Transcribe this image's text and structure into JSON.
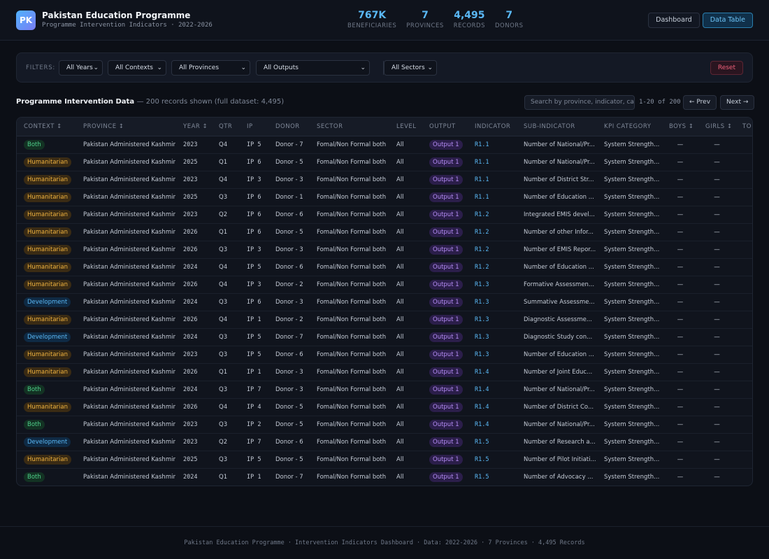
{
  "header": {
    "logo_text": "PK",
    "title": "Pakistan Education Programme",
    "subtitle": "Programme Intervention Indicators · 2022-2026",
    "stats": [
      {
        "value": "767K",
        "label": "BENEFICIARIES"
      },
      {
        "value": "7",
        "label": "PROVINCES"
      },
      {
        "value": "4,495",
        "label": "RECORDS"
      },
      {
        "value": "7",
        "label": "DONORS"
      }
    ],
    "nav": {
      "dashboard": "Dashboard",
      "data_table": "Data Table"
    }
  },
  "filters": {
    "label": "FILTERS:",
    "years": "All Years",
    "contexts": "All Contexts",
    "provinces": "All Provinces",
    "outputs": "All Outputs",
    "sectors": "All Sectors",
    "reset": "Reset"
  },
  "section": {
    "title": "Programme Intervention Data",
    "note": "— 200 records shown (full dataset: 4,495)",
    "search_placeholder": "Search by province, indicator, category...",
    "page_info": "1-20 of 200",
    "prev": "← Prev",
    "next": "Next →"
  },
  "table": {
    "columns": [
      "CONTEXT ↕",
      "PROVINCE ↕",
      "YEAR ↕",
      "QTR",
      "IP",
      "DONOR",
      "SECTOR",
      "LEVEL",
      "OUTPUT",
      "INDICATOR",
      "SUB-INDICATOR",
      "KPI CATEGORY",
      "BOYS ↕",
      "GIRLS ↕",
      "TO"
    ],
    "rows": [
      {
        "context": "Both",
        "province": "Pakistan Administered Kashmir",
        "year": "2023",
        "qtr": "Q4",
        "ip": "IP 5",
        "donor": "Donor - 7",
        "sector": "Fomal/Non Formal both",
        "level": "All",
        "output": "Output 1",
        "indicator": "R1.1",
        "sub": "Number of National/Pr...",
        "kpi": "System Strength...",
        "boys": "—",
        "girls": "—"
      },
      {
        "context": "Humanitarian",
        "province": "Pakistan Administered Kashmir",
        "year": "2025",
        "qtr": "Q1",
        "ip": "IP 6",
        "donor": "Donor - 5",
        "sector": "Fomal/Non Formal both",
        "level": "All",
        "output": "Output 1",
        "indicator": "R1.1",
        "sub": "Number of National/Pr...",
        "kpi": "System Strength...",
        "boys": "—",
        "girls": "—"
      },
      {
        "context": "Humanitarian",
        "province": "Pakistan Administered Kashmir",
        "year": "2023",
        "qtr": "Q4",
        "ip": "IP 3",
        "donor": "Donor - 3",
        "sector": "Fomal/Non Formal both",
        "level": "All",
        "output": "Output 1",
        "indicator": "R1.1",
        "sub": "Number of District Str...",
        "kpi": "System Strength...",
        "boys": "—",
        "girls": "—"
      },
      {
        "context": "Humanitarian",
        "province": "Pakistan Administered Kashmir",
        "year": "2025",
        "qtr": "Q3",
        "ip": "IP 6",
        "donor": "Donor - 1",
        "sector": "Fomal/Non Formal both",
        "level": "All",
        "output": "Output 1",
        "indicator": "R1.1",
        "sub": "Number of Education ...",
        "kpi": "System Strength...",
        "boys": "—",
        "girls": "—"
      },
      {
        "context": "Humanitarian",
        "province": "Pakistan Administered Kashmir",
        "year": "2023",
        "qtr": "Q2",
        "ip": "IP 6",
        "donor": "Donor - 6",
        "sector": "Fomal/Non Formal both",
        "level": "All",
        "output": "Output 1",
        "indicator": "R1.2",
        "sub": "Integrated EMIS devel...",
        "kpi": "System Strength...",
        "boys": "—",
        "girls": "—"
      },
      {
        "context": "Humanitarian",
        "province": "Pakistan Administered Kashmir",
        "year": "2026",
        "qtr": "Q1",
        "ip": "IP 6",
        "donor": "Donor - 5",
        "sector": "Fomal/Non Formal both",
        "level": "All",
        "output": "Output 1",
        "indicator": "R1.2",
        "sub": "Number of other Infor...",
        "kpi": "System Strength...",
        "boys": "—",
        "girls": "—"
      },
      {
        "context": "Humanitarian",
        "province": "Pakistan Administered Kashmir",
        "year": "2026",
        "qtr": "Q3",
        "ip": "IP 3",
        "donor": "Donor - 3",
        "sector": "Fomal/Non Formal both",
        "level": "All",
        "output": "Output 1",
        "indicator": "R1.2",
        "sub": "Number of EMIS Repor...",
        "kpi": "System Strength...",
        "boys": "—",
        "girls": "—"
      },
      {
        "context": "Humanitarian",
        "province": "Pakistan Administered Kashmir",
        "year": "2024",
        "qtr": "Q4",
        "ip": "IP 5",
        "donor": "Donor - 6",
        "sector": "Fomal/Non Formal both",
        "level": "All",
        "output": "Output 1",
        "indicator": "R1.2",
        "sub": "Number of Education ...",
        "kpi": "System Strength...",
        "boys": "—",
        "girls": "—"
      },
      {
        "context": "Humanitarian",
        "province": "Pakistan Administered Kashmir",
        "year": "2026",
        "qtr": "Q4",
        "ip": "IP 3",
        "donor": "Donor - 2",
        "sector": "Fomal/Non Formal both",
        "level": "All",
        "output": "Output 1",
        "indicator": "R1.3",
        "sub": "Formative Assessmen...",
        "kpi": "System Strength...",
        "boys": "—",
        "girls": "—"
      },
      {
        "context": "Development",
        "province": "Pakistan Administered Kashmir",
        "year": "2024",
        "qtr": "Q3",
        "ip": "IP 6",
        "donor": "Donor - 3",
        "sector": "Fomal/Non Formal both",
        "level": "All",
        "output": "Output 1",
        "indicator": "R1.3",
        "sub": "Summative Assessme...",
        "kpi": "System Strength...",
        "boys": "—",
        "girls": "—"
      },
      {
        "context": "Humanitarian",
        "province": "Pakistan Administered Kashmir",
        "year": "2026",
        "qtr": "Q4",
        "ip": "IP 1",
        "donor": "Donor - 2",
        "sector": "Fomal/Non Formal both",
        "level": "All",
        "output": "Output 1",
        "indicator": "R1.3",
        "sub": "Diagnostic Assessme...",
        "kpi": "System Strength...",
        "boys": "—",
        "girls": "—"
      },
      {
        "context": "Development",
        "province": "Pakistan Administered Kashmir",
        "year": "2024",
        "qtr": "Q3",
        "ip": "IP 5",
        "donor": "Donor - 7",
        "sector": "Fomal/Non Formal both",
        "level": "All",
        "output": "Output 1",
        "indicator": "R1.3",
        "sub": "Diagnostic Study con...",
        "kpi": "System Strength...",
        "boys": "—",
        "girls": "—"
      },
      {
        "context": "Humanitarian",
        "province": "Pakistan Administered Kashmir",
        "year": "2023",
        "qtr": "Q3",
        "ip": "IP 5",
        "donor": "Donor - 6",
        "sector": "Fomal/Non Formal both",
        "level": "All",
        "output": "Output 1",
        "indicator": "R1.3",
        "sub": "Number of Education ...",
        "kpi": "System Strength...",
        "boys": "—",
        "girls": "—"
      },
      {
        "context": "Humanitarian",
        "province": "Pakistan Administered Kashmir",
        "year": "2026",
        "qtr": "Q1",
        "ip": "IP 1",
        "donor": "Donor - 3",
        "sector": "Fomal/Non Formal both",
        "level": "All",
        "output": "Output 1",
        "indicator": "R1.4",
        "sub": "Number of Joint Educ...",
        "kpi": "System Strength...",
        "boys": "—",
        "girls": "—"
      },
      {
        "context": "Both",
        "province": "Pakistan Administered Kashmir",
        "year": "2024",
        "qtr": "Q3",
        "ip": "IP 7",
        "donor": "Donor - 3",
        "sector": "Fomal/Non Formal both",
        "level": "All",
        "output": "Output 1",
        "indicator": "R1.4",
        "sub": "Number of National/Pr...",
        "kpi": "System Strength...",
        "boys": "—",
        "girls": "—"
      },
      {
        "context": "Humanitarian",
        "province": "Pakistan Administered Kashmir",
        "year": "2026",
        "qtr": "Q4",
        "ip": "IP 4",
        "donor": "Donor - 5",
        "sector": "Fomal/Non Formal both",
        "level": "All",
        "output": "Output 1",
        "indicator": "R1.4",
        "sub": "Number of District Co...",
        "kpi": "System Strength...",
        "boys": "—",
        "girls": "—"
      },
      {
        "context": "Both",
        "province": "Pakistan Administered Kashmir",
        "year": "2023",
        "qtr": "Q3",
        "ip": "IP 2",
        "donor": "Donor - 5",
        "sector": "Fomal/Non Formal both",
        "level": "All",
        "output": "Output 1",
        "indicator": "R1.4",
        "sub": "Number of National/Pr...",
        "kpi": "System Strength...",
        "boys": "—",
        "girls": "—"
      },
      {
        "context": "Development",
        "province": "Pakistan Administered Kashmir",
        "year": "2023",
        "qtr": "Q2",
        "ip": "IP 7",
        "donor": "Donor - 6",
        "sector": "Fomal/Non Formal both",
        "level": "All",
        "output": "Output 1",
        "indicator": "R1.5",
        "sub": "Number of Research a...",
        "kpi": "System Strength...",
        "boys": "—",
        "girls": "—"
      },
      {
        "context": "Humanitarian",
        "province": "Pakistan Administered Kashmir",
        "year": "2025",
        "qtr": "Q3",
        "ip": "IP 5",
        "donor": "Donor - 5",
        "sector": "Fomal/Non Formal both",
        "level": "All",
        "output": "Output 1",
        "indicator": "R1.5",
        "sub": "Number of Pilot Initiati...",
        "kpi": "System Strength...",
        "boys": "—",
        "girls": "—"
      },
      {
        "context": "Both",
        "province": "Pakistan Administered Kashmir",
        "year": "2024",
        "qtr": "Q1",
        "ip": "IP 1",
        "donor": "Donor - 7",
        "sector": "Fomal/Non Formal both",
        "level": "All",
        "output": "Output 1",
        "indicator": "R1.5",
        "sub": "Number of Advocacy ...",
        "kpi": "System Strength...",
        "boys": "—",
        "girls": "—"
      }
    ]
  },
  "footer": {
    "text": "Pakistan Education Programme · Intervention Indicators Dashboard · Data: 2022-2026 · 7 Provinces · 4,495 Records"
  },
  "colors": {
    "background": "#0c0f16",
    "accent": "#5ab8f5",
    "both": "#4fd08b",
    "humanitarian": "#f0b33f",
    "development": "#5ab8f5",
    "output": "#b58cf5",
    "reset": "#f0607a"
  }
}
